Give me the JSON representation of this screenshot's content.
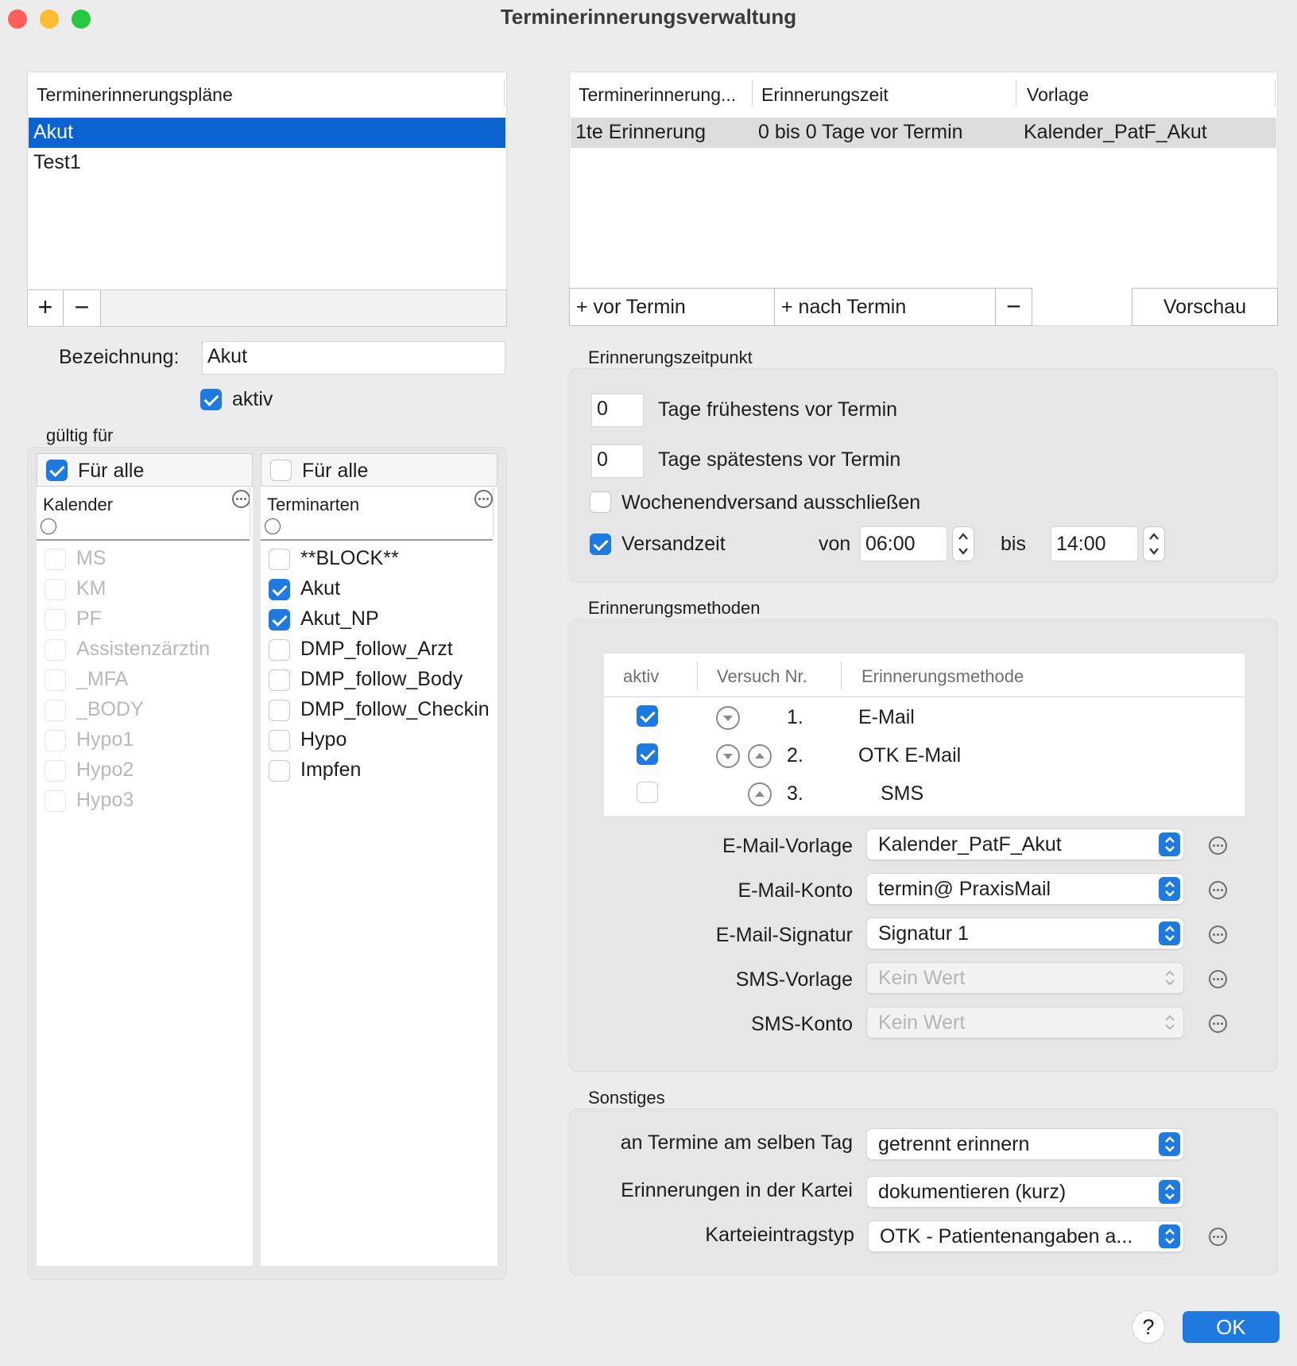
{
  "window": {
    "title": "Terminerinnerungsverwaltung"
  },
  "plans": {
    "header": "Terminerinnerungspläne",
    "items": [
      "Akut",
      "Test1"
    ],
    "selected": "Akut",
    "add": "+",
    "remove": "−"
  },
  "designation": {
    "label": "Bezeichnung:",
    "value": "Akut"
  },
  "active": {
    "label": "aktiv",
    "checked": true
  },
  "valid_for": {
    "label": "gültig für"
  },
  "calendars": {
    "all_label": "Für alle",
    "all_checked": true,
    "header": "Kalender",
    "items": [
      "MS",
      "KM",
      "PF",
      "Assistenzärztin",
      "_MFA",
      "_BODY",
      "Hypo1",
      "Hypo2",
      "Hypo3"
    ]
  },
  "types": {
    "all_label": "Für alle",
    "all_checked": false,
    "header": "Terminarten",
    "items": [
      {
        "label": "**BLOCK**",
        "checked": false
      },
      {
        "label": "Akut",
        "checked": true
      },
      {
        "label": "Akut_NP",
        "checked": true
      },
      {
        "label": "DMP_follow_Arzt",
        "checked": false
      },
      {
        "label": "DMP_follow_Body",
        "checked": false
      },
      {
        "label": "DMP_follow_Checkin",
        "checked": false
      },
      {
        "label": "Hypo",
        "checked": false
      },
      {
        "label": "Impfen",
        "checked": false
      }
    ]
  },
  "reminders": {
    "columns": [
      "Terminerinnerung...",
      "Erinnerungszeit",
      "Vorlage"
    ],
    "rows": [
      {
        "name": "1te Erinnerung",
        "time": "0 bis 0 Tage vor Termin",
        "template": "Kalender_PatF_Akut"
      }
    ],
    "btn_before": "+ vor Termin",
    "btn_after": "+ nach Termin",
    "btn_remove": "−",
    "btn_preview": "Vorschau"
  },
  "timing": {
    "section": "Erinnerungszeitpunkt",
    "earliest_value": "0",
    "earliest_label": "Tage frühestens vor Termin",
    "latest_value": "0",
    "latest_label": "Tage spätestens vor Termin",
    "weekend_label": "Wochenendversand ausschließen",
    "weekend_checked": false,
    "sendtime_label": "Versandzeit",
    "sendtime_checked": true,
    "from_label": "von",
    "from_value": "06:00",
    "to_label": "bis",
    "to_value": "14:00"
  },
  "methods": {
    "section": "Erinnerungsmethoden",
    "columns": [
      "aktiv",
      "Versuch Nr.",
      "Erinnerungsmethode"
    ],
    "rows": [
      {
        "checked": true,
        "nr": "1.",
        "method": "E-Mail"
      },
      {
        "checked": true,
        "nr": "2.",
        "method": "OTK E-Mail"
      },
      {
        "checked": false,
        "nr": "3.",
        "method": "SMS"
      }
    ],
    "email_template_label": "E-Mail-Vorlage",
    "email_template_value": "Kalender_PatF_Akut",
    "email_account_label": "E-Mail-Konto",
    "email_account_value": "termin@ PraxisMail",
    "email_signature_label": "E-Mail-Signatur",
    "email_signature_value": "Signatur 1",
    "sms_template_label": "SMS-Vorlage",
    "sms_template_value": "Kein Wert",
    "sms_account_label": "SMS-Konto",
    "sms_account_value": "Kein Wert"
  },
  "misc": {
    "section": "Sonstiges",
    "same_day_label": "an Termine am selben Tag",
    "same_day_value": "getrennt erinnern",
    "record_label": "Erinnerungen in der Kartei",
    "record_value": "dokumentieren (kurz)",
    "entry_type_label": "Karteieintragstyp",
    "entry_type_value": "OTK - Patientenangaben a..."
  },
  "footer": {
    "help": "?",
    "ok": "OK"
  },
  "colors": {
    "accent": "#1f7ae0",
    "selection": "#0b63d1"
  }
}
